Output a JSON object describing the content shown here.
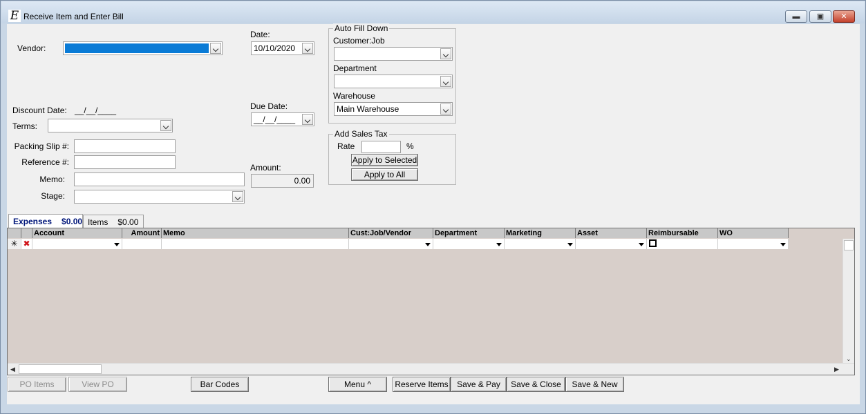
{
  "window": {
    "title": "Receive Item and Enter Bill",
    "app_icon": "E",
    "controls": {
      "minimize": "▬",
      "restore": "▣",
      "close": "✕"
    }
  },
  "form": {
    "vendor": {
      "label": "Vendor:",
      "value": ""
    },
    "date": {
      "label": "Date:",
      "value": "10/10/2020"
    },
    "discount_date": {
      "label": "Discount Date:",
      "value": "__/__/____"
    },
    "due_date": {
      "label": "Due Date:",
      "value": "__/__/____"
    },
    "terms": {
      "label": "Terms:",
      "value": ""
    },
    "packing_slip": {
      "label": "Packing Slip #:",
      "value": ""
    },
    "reference": {
      "label": "Reference #:",
      "value": ""
    },
    "memo": {
      "label": "Memo:",
      "value": ""
    },
    "stage": {
      "label": "Stage:",
      "value": ""
    },
    "amount": {
      "label": "Amount:",
      "value": "0.00"
    }
  },
  "auto_fill": {
    "title": "Auto Fill Down",
    "customer_job": {
      "label": "Customer:Job",
      "value": ""
    },
    "department": {
      "label": "Department",
      "value": ""
    },
    "warehouse": {
      "label": "Warehouse",
      "value": "Main Warehouse"
    }
  },
  "sales_tax": {
    "title": "Add Sales Tax",
    "rate_label": "Rate",
    "rate_value": "",
    "percent": "%",
    "apply_selected": "Apply to Selected",
    "apply_all": "Apply to All"
  },
  "tabs": [
    {
      "label": "Expenses",
      "amount": "$0.00"
    },
    {
      "label": "Items",
      "amount": "$0.00"
    }
  ],
  "grid": {
    "columns": [
      "Account",
      "Amount",
      "Memo",
      "Cust:Job/Vendor",
      "Department",
      "Marketing",
      "Asset",
      "Reimbursable",
      "WO"
    ],
    "new_row_marker": "✳",
    "delete_icon": "✖"
  },
  "buttons": {
    "po_items": "PO Items",
    "view_po": "View PO",
    "bar_codes": "Bar Codes",
    "menu": "Menu ^",
    "reserve_items": "Reserve Items",
    "save_pay": "Save & Pay",
    "save_close": "Save & Close",
    "save_new": "Save & New"
  },
  "colors": {
    "selection": "#0a7bd6",
    "grid_background": "#d8cfca",
    "active_tab_text": "#00167a",
    "close_button": "#c4412c"
  }
}
